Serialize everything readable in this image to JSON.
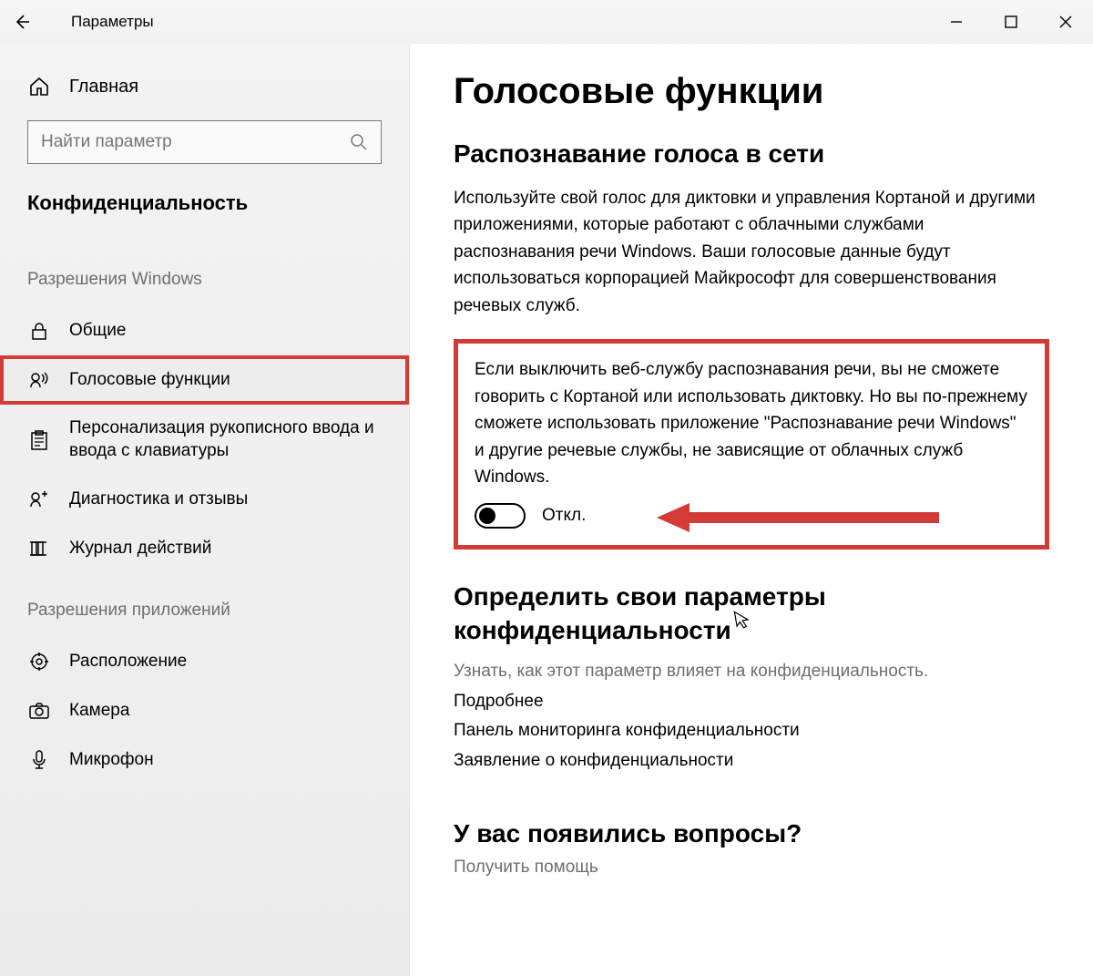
{
  "titlebar": {
    "title": "Параметры"
  },
  "sidebar": {
    "home": "Главная",
    "search_placeholder": "Найти параметр",
    "category": "Конфиденциальность",
    "group1": "Разрешения Windows",
    "items1": [
      {
        "label": "Общие"
      },
      {
        "label": "Голосовые функции"
      },
      {
        "label": "Персонализация рукописного ввода и ввода с клавиатуры"
      },
      {
        "label": "Диагностика и отзывы"
      },
      {
        "label": "Журнал действий"
      }
    ],
    "group2": "Разрешения приложений",
    "items2": [
      {
        "label": "Расположение"
      },
      {
        "label": "Камера"
      },
      {
        "label": "Микрофон"
      }
    ]
  },
  "main": {
    "title": "Голосовые функции",
    "subheading": "Распознавание голоса в сети",
    "para1": "Используйте свой голос для диктовки и управления Кортаной и другими приложениями, которые работают с облачными службами распознавания речи Windows. Ваши голосовые данные будут использоваться корпорацией Майкрософт для совершенствования речевых служб.",
    "para2": "Если выключить веб-службу распознавания речи, вы не сможете говорить с Кортаной или использовать диктовку. Но вы по-прежнему сможете использовать приложение \"Распознавание речи Windows\" и другие речевые службы, не зависящие от облачных служб Windows.",
    "toggle_label": "Откл.",
    "privacy_heading": "Определить свои параметры конфиденциальности",
    "privacy_sub": "Узнать, как этот параметр влияет на конфиденциальность.",
    "links": [
      "Подробнее",
      "Панель мониторинга конфиденциальности",
      "Заявление о конфиденциальности"
    ],
    "help_heading": "У вас появились вопросы?",
    "help_link": "Получить помощь"
  }
}
